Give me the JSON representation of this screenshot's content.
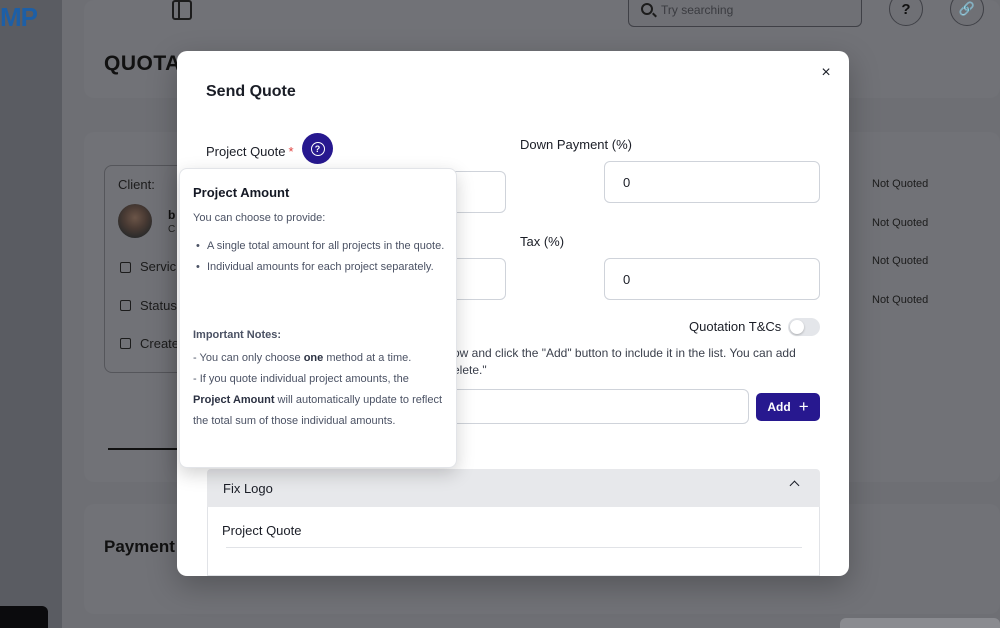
{
  "app": {
    "logo_text": "MP",
    "search_placeholder": "Try searching",
    "help_glyph": "?",
    "link_glyph": "🔗",
    "page_title": "QUOTA",
    "client_label": "Client:",
    "client_name": "b",
    "client_sub": "C",
    "rows": [
      "Servic",
      "Status",
      "Create"
    ],
    "payment_title": "Payment",
    "status_values": [
      "Not Quoted",
      "Not Quoted",
      "Not Quoted",
      "Not Quoted"
    ]
  },
  "modal": {
    "title": "Send Quote",
    "close_glyph": "×",
    "project_quote_label": "Project Quote",
    "required_mark": "*",
    "help_glyph": "?",
    "project_quote_value": "",
    "down_payment_label": "Down Payment (%)",
    "down_payment_value": "0",
    "tax_label": "Tax (%)",
    "tax_value": "0",
    "left_input_2_value": "",
    "tc_toggle_label": "Quotation T&Cs",
    "instruction_text": "ow and click the \"Add\" button to include it in the list. You can add",
    "instruction_text_2": "elete.\"",
    "add_input_value": "",
    "add_button_label": "Add",
    "add_button_icon": "+",
    "accordion": {
      "title": "Fix Logo",
      "field_label": "Project Quote"
    }
  },
  "tooltip": {
    "title": "Project Amount",
    "intro": "You can choose to provide:",
    "bullets": [
      "A single total amount for all projects in the quote.",
      "Individual amounts for each project separately."
    ],
    "notes_title": "Important Notes:",
    "note1_prefix": "- You can only choose ",
    "note1_bold": "one",
    "note1_suffix": " method at a time.",
    "note2_prefix": "- If you quote individual project amounts, the ",
    "note2_bold": "Project Amount",
    "note2_suffix": " will automatically update to reflect the total sum of those individual amounts."
  },
  "colors": {
    "accent": "#27188f",
    "required": "#e0413e",
    "accordion_bg": "#e7e8eb"
  }
}
